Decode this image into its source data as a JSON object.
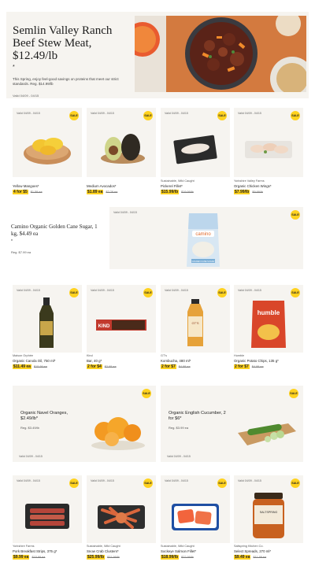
{
  "hero": {
    "title": "Semlin Valley Ranch Beef Stew Meat, $12.49/lb",
    "asterisk": "*",
    "description": "This Spring, enjoy feel-good savings on proteins that meet our strict standards. Reg. $14.99/lb",
    "valid": "Valid 04/09 - 04/15"
  },
  "sale_label": "SALE",
  "products_row1": [
    {
      "valid": "Valid 04/09 - 04/15",
      "brand": "",
      "name": "Yellow Mangoes*",
      "price": "4 for $5",
      "reg": "$1.59 ea"
    },
    {
      "valid": "Valid 04/09 - 04/15",
      "brand": "",
      "name": "Medium Avocados*",
      "price": "$1.89 ea",
      "reg": "$2.29 ea"
    },
    {
      "valid": "Valid 04/09 - 04/15",
      "brand": "Sustainable, Wild Caught",
      "name": "Pickerel Fillet*",
      "price": "$15.99/lb",
      "reg": "$19.99/lb"
    },
    {
      "valid": "Valid 04/09 - 04/15",
      "brand": "Yorkshire Valley Farms",
      "name": "Organic Chicken Wings*",
      "price": "$7.99/lb",
      "reg": "$9.99/lb"
    }
  ],
  "featured": {
    "title": "Camino Organic Golden Cane Sugar, 1 kg, $4.49 ea",
    "asterisk": "*",
    "reg": "Reg. $7.99 ea",
    "valid": "Valid 04/09 - 04/15",
    "package_brand": "camino",
    "package_text": "GOLDEN CANE SUGAR"
  },
  "products_row2": [
    {
      "valid": "Valid 04/09 - 04/15",
      "brand": "Maison Orphée",
      "name": "Organic Canola Oil, 750 ml*",
      "price": "$11.49 ea",
      "reg": "$15.99 ea"
    },
    {
      "valid": "Valid 04/09 - 04/15",
      "brand": "Kind",
      "name": "Bar, 40 g*",
      "price": "2 for $4",
      "reg": "$2.69 ea"
    },
    {
      "valid": "Valid 04/09 - 04/15",
      "brand": "GT's",
      "name": "Kombucha, 480 ml*",
      "price": "2 for $7",
      "reg": "$4.99 ea"
    },
    {
      "valid": "Valid 04/09 - 04/15",
      "brand": "Humble",
      "name": "Organic Potato Chips, 135 g*",
      "price": "2 for $7",
      "reg": "$4.99 ea"
    }
  ],
  "wide_cards": [
    {
      "title": "Organic Navel Oranges, $2.49/lb*",
      "reg": "Reg. $3.49/lb",
      "valid": "Valid 04/09 - 04/15"
    },
    {
      "title": "Organic English Cucumber, 2 for $6*",
      "reg": "Reg. $3.99 ea",
      "valid": "Valid 04/09 - 04/15"
    }
  ],
  "products_row3": [
    {
      "valid": "Valid 04/09 - 04/15",
      "brand": "Yorkshire Farms",
      "name": "Pork Breakfast Strips, 375 g*",
      "price": "$9.99 ea",
      "reg": "$15.99 ea"
    },
    {
      "valid": "Valid 04/09 - 04/15",
      "brand": "Sustainable, Wild Caught",
      "name": "Snow Crab Clusters*",
      "price": "$25.99/lb",
      "reg": "$31.99/lb"
    },
    {
      "valid": "Valid 04/09 - 04/15",
      "brand": "Sustainable, Wild Caught",
      "name": "Sockeye Salmon Fillet*",
      "price": "$18.99/lb",
      "reg": "$22.99/lb"
    },
    {
      "valid": "Valid 04/09 - 04/15",
      "brand": "Saltspring Kitchen Co.",
      "name": "Select Spreads, 270 ml*",
      "price": "$9.49 ea",
      "reg": "$11.99 ea"
    }
  ],
  "brand_texts": {
    "kind": "KIND",
    "humble": "humble",
    "gts": "GT'S",
    "saltspring": "SALTSPRING"
  }
}
